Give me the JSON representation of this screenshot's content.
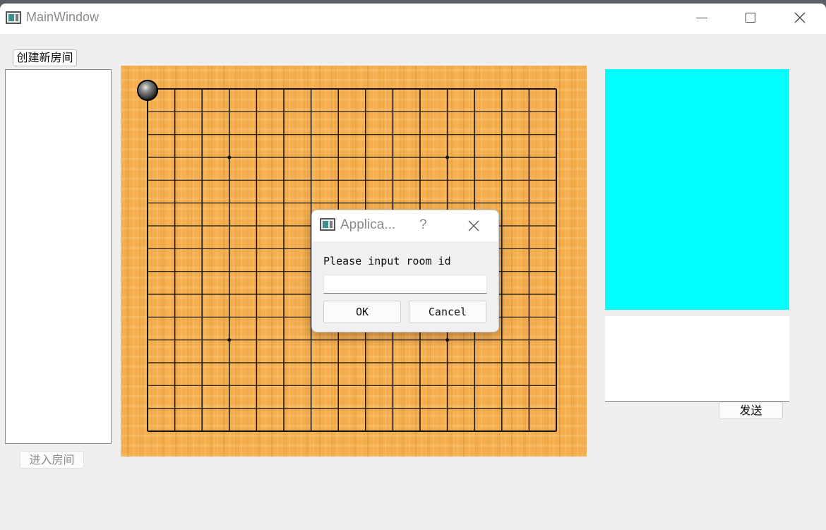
{
  "window": {
    "title": "MainWindow",
    "icon": "app-window-icon",
    "controls": {
      "minimize": "minimize-icon",
      "maximize": "maximize-icon",
      "close": "close-icon"
    }
  },
  "left_panel": {
    "create_room_label": "创建新房间",
    "enter_room_label": "进入房间",
    "room_list": []
  },
  "board": {
    "grid_size": 16,
    "background_color": "#f5ae4e",
    "star_points": [
      [
        3,
        3
      ],
      [
        11,
        3
      ],
      [
        3,
        11
      ],
      [
        11,
        11
      ]
    ],
    "stones": [
      {
        "color": "black",
        "col": 0,
        "row": 0
      }
    ]
  },
  "right_panel": {
    "chat_display_color": "#00ffff",
    "chat_input_value": "",
    "send_label": "发送"
  },
  "dialog": {
    "title": "Applica...",
    "help": "?",
    "label": "Please input room id",
    "input_value": "",
    "ok_label": "OK",
    "cancel_label": "Cancel"
  }
}
